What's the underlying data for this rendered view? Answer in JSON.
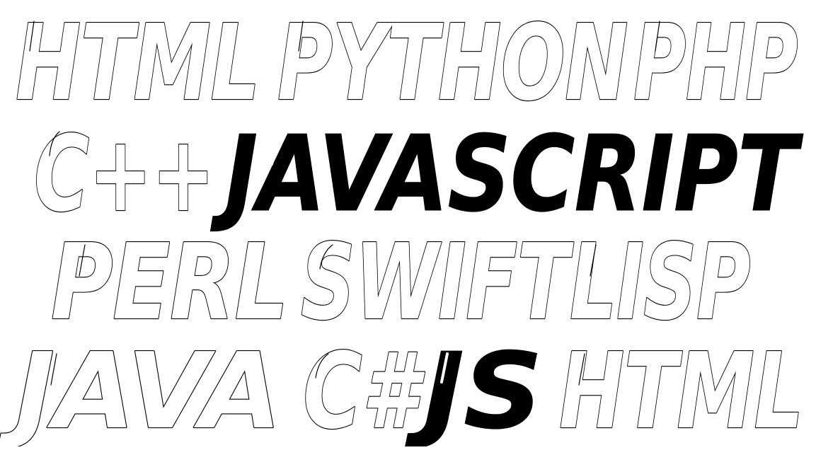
{
  "rows": [
    {
      "words": [
        {
          "text": "HTML",
          "style": "outline"
        },
        {
          "text": "PYTHON",
          "style": "outline"
        },
        {
          "text": "PHP",
          "style": "outline"
        }
      ]
    },
    {
      "words": [
        {
          "text": "C++",
          "style": "outline"
        },
        {
          "text": "JAVASCRIPT",
          "style": "solid"
        }
      ]
    },
    {
      "words": [
        {
          "text": "PERL",
          "style": "outline"
        },
        {
          "text": "SWIFT",
          "style": "outline"
        },
        {
          "text": "LISP",
          "style": "outline"
        }
      ]
    },
    {
      "words": [
        {
          "text": "JAVA",
          "style": "outline"
        },
        {
          "text": "C#",
          "style": "outline"
        },
        {
          "text": "JS",
          "style": "solid"
        },
        {
          "text": "HTML",
          "style": "outline"
        }
      ]
    }
  ],
  "colors": {
    "background": "#ffffff",
    "ink": "#000000"
  }
}
